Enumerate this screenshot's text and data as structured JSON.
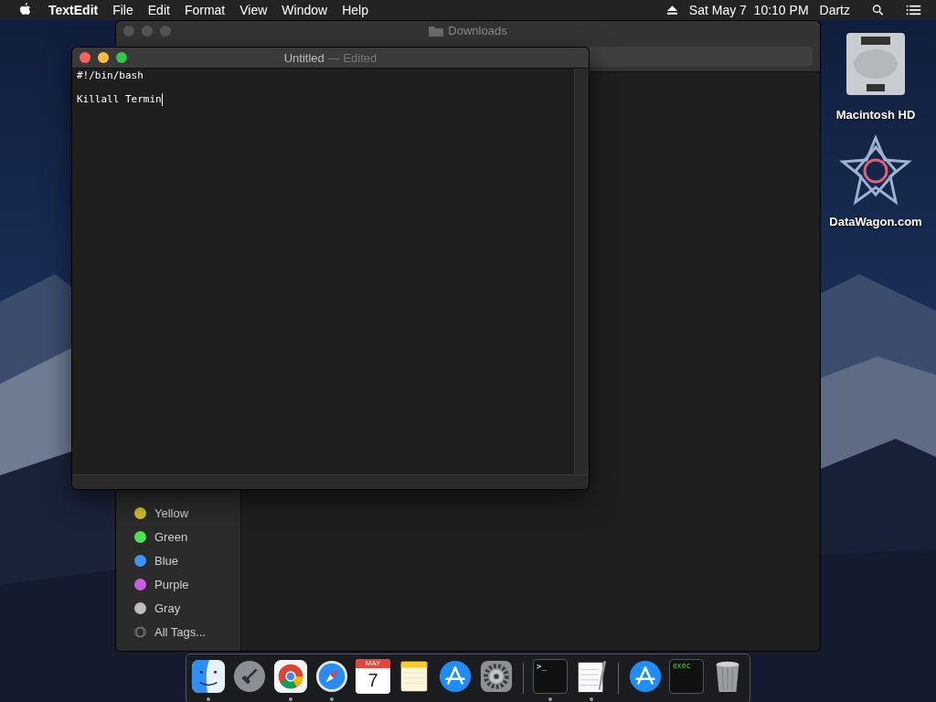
{
  "menu_bar": {
    "app_name": "TextEdit",
    "menus": [
      "File",
      "Edit",
      "Format",
      "View",
      "Window",
      "Help"
    ],
    "date_time": "Sat May 7  10:10 PM",
    "user": "Dartz"
  },
  "desktop_icons": [
    {
      "kind": "drive",
      "label": "Macintosh HD"
    },
    {
      "kind": "star",
      "label": "DataWagon.com"
    }
  ],
  "finder_window": {
    "title": "Downloads",
    "sidebar_tags": [
      {
        "kind": "tag",
        "label": "Yellow",
        "color": "#d4bf2c"
      },
      {
        "kind": "tag",
        "label": "Green",
        "color": "#4ee24e"
      },
      {
        "kind": "tag",
        "label": "Blue",
        "color": "#3d96f5"
      },
      {
        "kind": "tag",
        "label": "Purple",
        "color": "#c95ee6"
      },
      {
        "kind": "tag",
        "label": "Gray",
        "color": "#bdbdbd"
      },
      {
        "kind": "all",
        "label": "All Tags..."
      }
    ]
  },
  "textedit_window": {
    "title": "Untitled",
    "status": "— Edited",
    "lines": [
      "#!/bin/bash",
      "Killall Termin"
    ]
  },
  "dock": {
    "items": [
      {
        "kind": "finder",
        "running": true
      },
      {
        "kind": "launchpad",
        "running": false
      },
      {
        "kind": "chrome",
        "running": true
      },
      {
        "kind": "safari",
        "running": true
      },
      {
        "kind": "calendar",
        "month": "MAY",
        "day": "7",
        "running": false
      },
      {
        "kind": "notes",
        "running": false
      },
      {
        "kind": "appstore",
        "running": false
      },
      {
        "kind": "preferences",
        "running": false
      },
      {
        "kind": "separator"
      },
      {
        "kind": "terminal",
        "prompt": ">_",
        "running": true
      },
      {
        "kind": "textedit",
        "running": true
      },
      {
        "kind": "separator"
      },
      {
        "kind": "appstore",
        "running": false
      },
      {
        "kind": "exec",
        "label": "exec",
        "running": false
      },
      {
        "kind": "trash",
        "running": false
      }
    ]
  }
}
